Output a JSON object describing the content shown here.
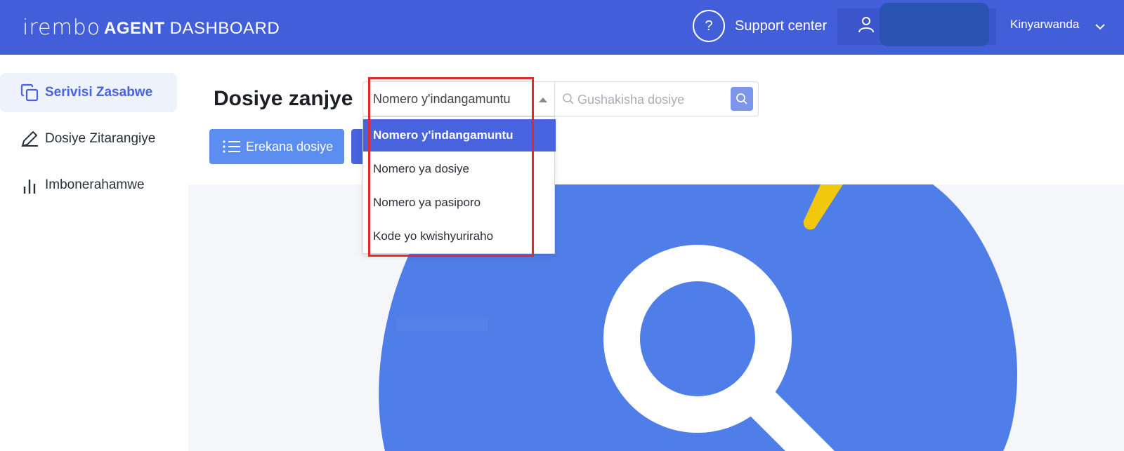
{
  "header": {
    "logo_text": "irembo",
    "title_bold": "AGENT",
    "title_rest": " DASHBOARD",
    "help_icon_glyph": "?",
    "support_label": "Support center",
    "language": "Kinyarwanda",
    "bar_color": "#425ed9"
  },
  "sidebar": {
    "items": [
      {
        "label": "Serivisi Zasabwe",
        "icon": "copy-icon",
        "active": true
      },
      {
        "label": "Dosiye Zitarangiye",
        "icon": "pencil-icon",
        "active": false
      },
      {
        "label": "Imbonerahamwe",
        "icon": "bar-chart-icon",
        "active": false
      }
    ]
  },
  "main": {
    "title": "Dosiye zanjye",
    "search_type_selected": "Nomero y'indangamuntu",
    "search_placeholder": "Gushakisha dosiye",
    "list_button_label": "Erekana dosiye",
    "dropdown_options": [
      "Nomero y'indangamuntu",
      "Nomero ya dosiye",
      "Nomero ya pasiporo",
      "Kode yo kwishyuriraho"
    ],
    "accent_color": "#4763dd",
    "highlight_color": "#e02a2a"
  }
}
